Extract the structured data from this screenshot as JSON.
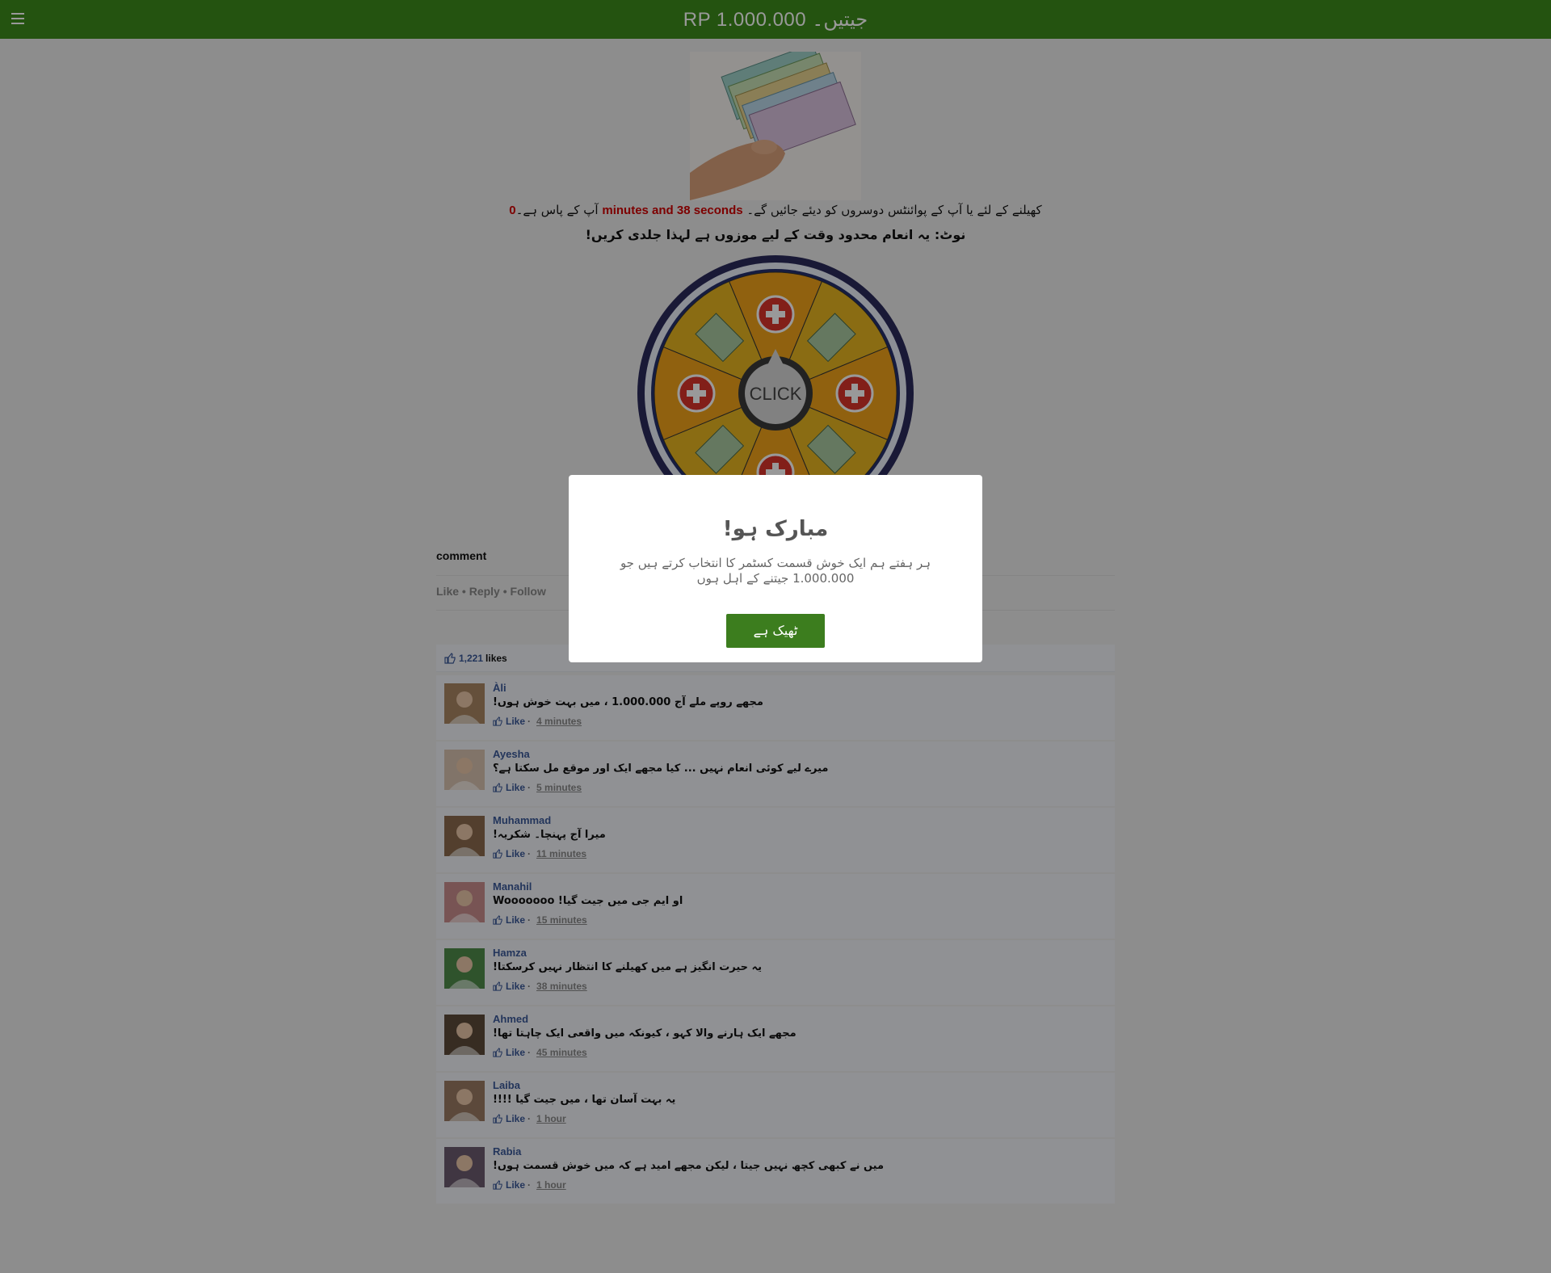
{
  "header": {
    "title": "RP 1.000.000 جیتیں۔",
    "menu_icon": "hamburger-menu-icon"
  },
  "colors": {
    "brand_green": "#3c8b1c",
    "button_green": "#3c7d1e",
    "highlight_red": "#d10000",
    "link_blue": "#3b5998"
  },
  "promo": {
    "line1_prefix": "کھیلنے کے لئے یا آپ کے پوائنٹس دوسروں کو دیئے جائیں گے۔",
    "line1_timer": "minutes and 38 seconds",
    "line1_suffix": "آپ کے پاس ہے۔",
    "line1_count": "0",
    "line2": "نوٹ: یہ انعام محدود وقت کے لیے موزوں ہے لہذا جلدی کریں!"
  },
  "wheel": {
    "center_label": "CLICK"
  },
  "comment_section": {
    "label": "comment",
    "actions": {
      "like": "Like",
      "reply": "Reply",
      "follow": "Follow",
      "separator": "•"
    }
  },
  "likes": {
    "count": "1,221",
    "label": "likes"
  },
  "comments": [
    {
      "name": "Àli",
      "text": "مجھے روپے ملے آج 1.000.000 ، میں بہت خوش ہوں!",
      "like": "Like",
      "time": "4 minutes",
      "avatar_color": "#a88563"
    },
    {
      "name": "Ayesha",
      "text": "میرے لیے کوئی انعام نہیں ... کیا مجھے ایک اور موقع مل سکتا ہے؟",
      "like": "Like",
      "time": "5 minutes",
      "avatar_color": "#d8c1b0"
    },
    {
      "name": "Muhammad",
      "text": "میرا آج پہنچا۔ شکریہ!",
      "like": "Like",
      "time": "11 minutes",
      "avatar_color": "#8a6a4e"
    },
    {
      "name": "Manahil",
      "text": "او ایم جی میں جیت گیا! Wooooooo",
      "like": "Like",
      "time": "15 minutes",
      "avatar_color": "#c98c8c"
    },
    {
      "name": "Hamza",
      "text": "یہ حیرت انگیز ہے میں کھیلنے کا انتظار نہیں کرسکتا!",
      "like": "Like",
      "time": "38 minutes",
      "avatar_color": "#4f8b4a"
    },
    {
      "name": "Ahmed",
      "text": "مجھے ایک ہارنے والا کہو ، کیونکہ میں واقعی ایک چاہتا تھا!",
      "like": "Like",
      "time": "45 minutes",
      "avatar_color": "#5d4a3a"
    },
    {
      "name": "Laiba",
      "text": "یہ بہت آسان تھا ، میں جیت گیا !!!!",
      "like": "Like",
      "time": "1 hour",
      "avatar_color": "#9a7b63"
    },
    {
      "name": "Rabia",
      "text": "میں نے کبھی کچھ نہیں جیتا ، لیکن مجھے امید ہے کہ میں خوش قسمت ہوں!",
      "like": "Like",
      "time": "1 hour",
      "avatar_color": "#6b5a6e"
    }
  ],
  "modal": {
    "title": "مبارک ہو!",
    "body": "ہر ہفتے ہم ایک خوش قسمت کسٹمر کا انتخاب کرتے ہیں جو 1.000.000 جیتنے کے اہل ہوں",
    "ok_button": "ٹھیک ہے"
  }
}
